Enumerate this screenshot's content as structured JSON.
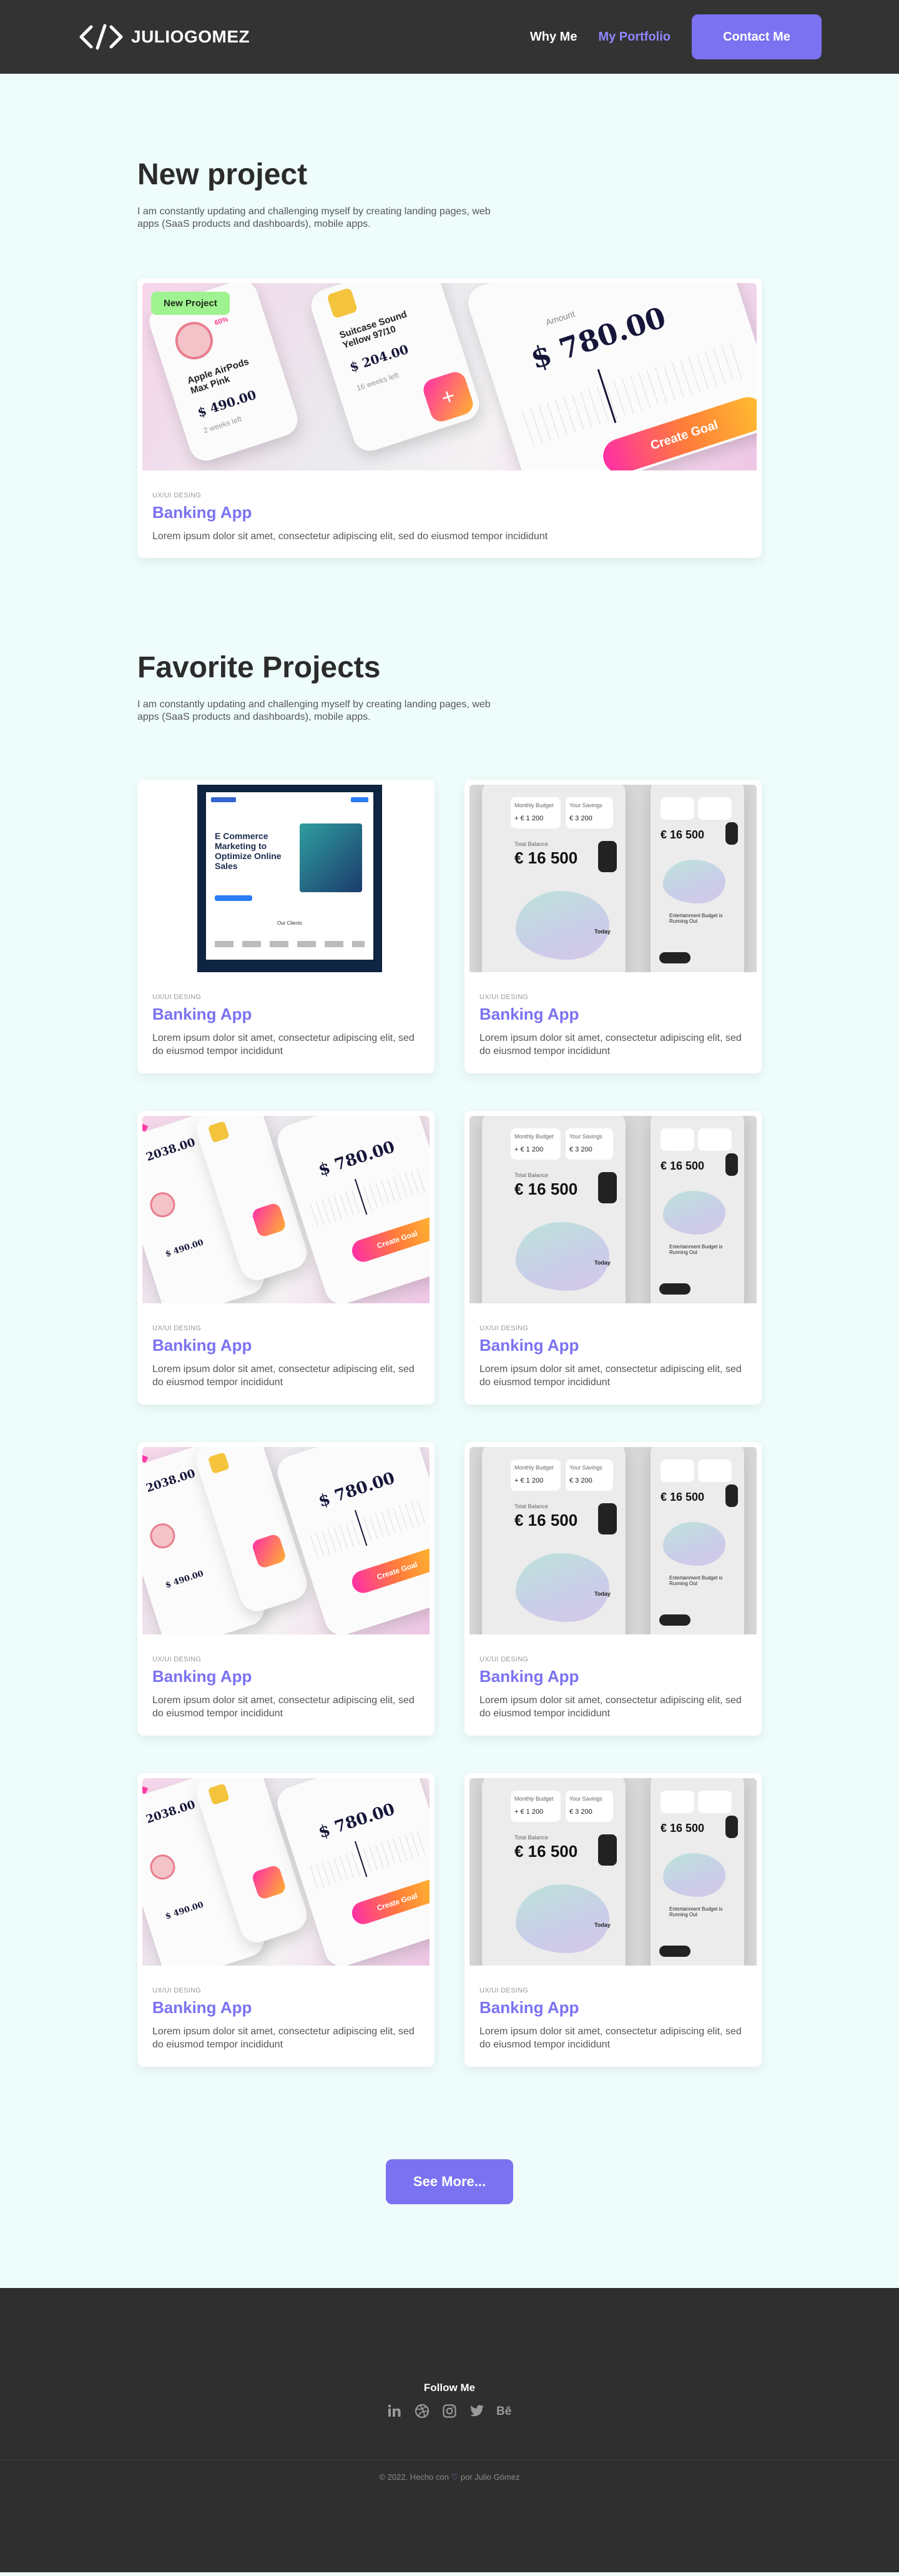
{
  "header": {
    "brand": "JULIOGOMEZ",
    "nav": [
      {
        "label": "Why Me",
        "active": false
      },
      {
        "label": "My Portfolio",
        "active": true
      }
    ],
    "cta": "Contact Me"
  },
  "new_section": {
    "title": "New project",
    "description": "I am constantly updating and challenging myself by creating landing pages, web apps (SaaS products and dashboards), mobile apps.",
    "card": {
      "badge": "New Project",
      "category": "UX/UI DESING",
      "title": "Banking App",
      "description": "Lorem ipsum dolor sit amet, consectetur adipiscing elit, sed do eiusmod tempor incididunt",
      "art": {
        "product": "Apple AirPods Max Pink",
        "product_price": "$ 490.00",
        "product_time": "2 weeks left",
        "percent": "60%",
        "suitcase": "Suitcase Sound Yellow 97/10",
        "suitcase_price": "$ 204.00",
        "suitcase_time": "16 weeks left",
        "amount_label": "Amount",
        "amount": "$ 780.00",
        "goal_button": "Create Goal"
      }
    }
  },
  "favorites": {
    "title": "Favorite Projects",
    "description": "I am constantly updating and challenging myself by creating landing pages, web apps (SaaS products and dashboards), mobile apps.",
    "cards": [
      {
        "category": "UX/UI DESING",
        "title": "Banking App",
        "description": "Lorem ipsum dolor sit amet, consectetur adipiscing elit, sed do eiusmod tempor incididunt",
        "art": "ecommerce"
      },
      {
        "category": "UX/UI DESING",
        "title": "Banking App",
        "description": "Lorem ipsum dolor sit amet, consectetur adipiscing elit, sed do eiusmod tempor incididunt",
        "art": "wallet"
      },
      {
        "category": "UX/UI DESING",
        "title": "Banking App",
        "description": "Lorem ipsum dolor sit amet, consectetur adipiscing elit, sed do eiusmod tempor incididunt",
        "art": "goals"
      },
      {
        "category": "UX/UI DESING",
        "title": "Banking App",
        "description": "Lorem ipsum dolor sit amet, consectetur adipiscing elit, sed do eiusmod tempor incididunt",
        "art": "wallet"
      },
      {
        "category": "UX/UI DESING",
        "title": "Banking App",
        "description": "Lorem ipsum dolor sit amet, consectetur adipiscing elit, sed do eiusmod tempor incididunt",
        "art": "goals"
      },
      {
        "category": "UX/UI DESING",
        "title": "Banking App",
        "description": "Lorem ipsum dolor sit amet, consectetur adipiscing elit, sed do eiusmod tempor incididunt",
        "art": "wallet"
      },
      {
        "category": "UX/UI DESING",
        "title": "Banking App",
        "description": "Lorem ipsum dolor sit amet, consectetur adipiscing elit, sed do eiusmod tempor incididunt",
        "art": "goals"
      },
      {
        "category": "UX/UI DESING",
        "title": "Banking App",
        "description": "Lorem ipsum dolor sit amet, consectetur adipiscing elit, sed do eiusmod tempor incididunt",
        "art": "wallet"
      }
    ],
    "art_text": {
      "ecommerce_heading": "E Commerce Marketing to Optimize Online Sales",
      "ecommerce_clients": "Our Clients",
      "wallet_budget": "Monthly Budget",
      "wallet_budget_value": "+ € 1 200",
      "wallet_savings": "Your Savings",
      "wallet_savings_value": "€ 3 200",
      "wallet_total_label": "Total Balance",
      "wallet_total": "€ 16 500",
      "wallet_today": "Today",
      "wallet_entertainment": "Entertainment Budget is Running Out",
      "goals_amount": "$ 780.00",
      "goals_price": "$ 2038.00",
      "goals_small_price": "$ 490.00",
      "goals_button": "Create Goal"
    }
  },
  "more_button": "See More...",
  "footer": {
    "follow": "Follow Me",
    "social": [
      "linkedin-icon",
      "dribbble-icon",
      "instagram-icon",
      "twitter-icon",
      "behance-icon"
    ],
    "copyright_pre": "© 2022. Hecho con",
    "copyright_post": "por Julio Gómez"
  },
  "colors": {
    "accent": "#7b72f2",
    "header_bg": "#333333",
    "page_bg": "#eefdfb",
    "badge": "#9ef28f"
  }
}
